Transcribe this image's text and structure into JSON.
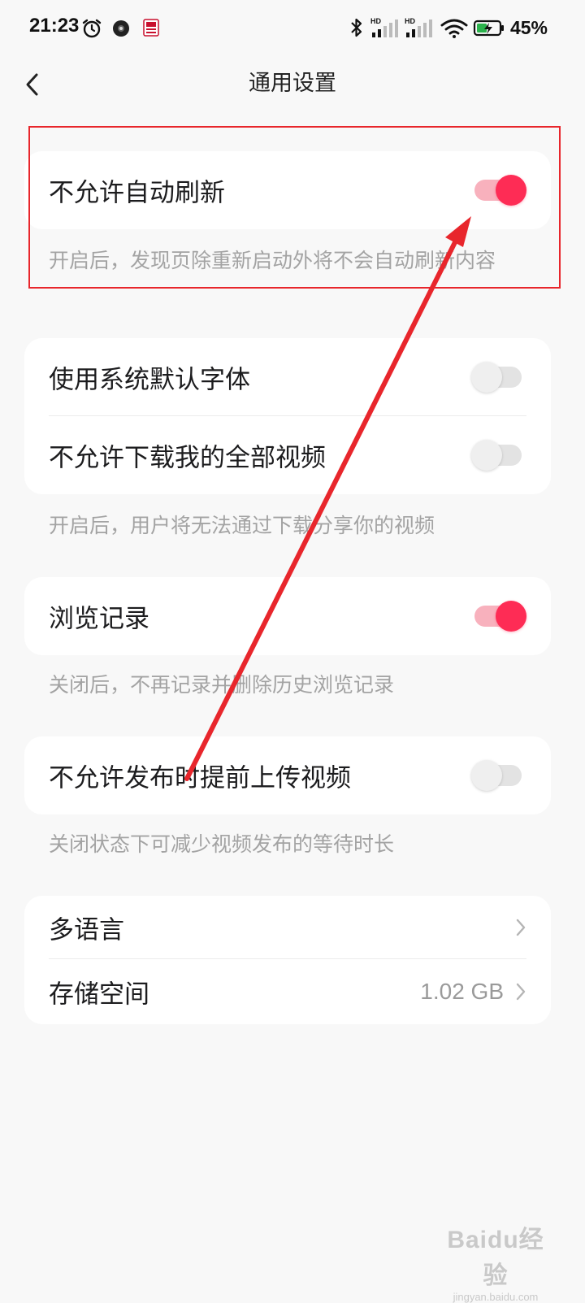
{
  "status_bar": {
    "time": "21:23",
    "battery_percent": "45%",
    "battery_level": 0.45,
    "icons": [
      "alarm-icon",
      "camera-notification-icon",
      "app-notification-icon",
      "bluetooth-icon",
      "signal-icon",
      "signal-icon",
      "wifi-icon",
      "battery-charging-icon"
    ]
  },
  "nav": {
    "title": "通用设置",
    "back_icon": "chevron-left-icon"
  },
  "groups": {
    "auto_refresh": {
      "label": "不允许自动刷新",
      "toggle_on": true,
      "hint": "开启后，发现页除重新启动外将不会自动刷新内容"
    },
    "fonts_download": {
      "system_font_label": "使用系统默认字体",
      "system_font_on": false,
      "download_label": "不允许下载我的全部视频",
      "download_on": false,
      "hint": "开启后，用户将无法通过下载分享你的视频"
    },
    "history": {
      "label": "浏览记录",
      "toggle_on": true,
      "hint": "关闭后，不再记录并删除历史浏览记录"
    },
    "upload": {
      "label": "不允许发布时提前上传视频",
      "toggle_on": false,
      "hint": "关闭状态下可减少视频发布的等待时长"
    },
    "misc": {
      "language_label": "多语言",
      "storage_label": "存储空间",
      "storage_value": "1.02 GB"
    }
  },
  "colors": {
    "accent": "#fe2c55",
    "annotation": "#e8262c",
    "background": "#f8f8f8"
  },
  "watermark": {
    "logo": "Baidu经验",
    "url": "jingyan.baidu.com"
  }
}
